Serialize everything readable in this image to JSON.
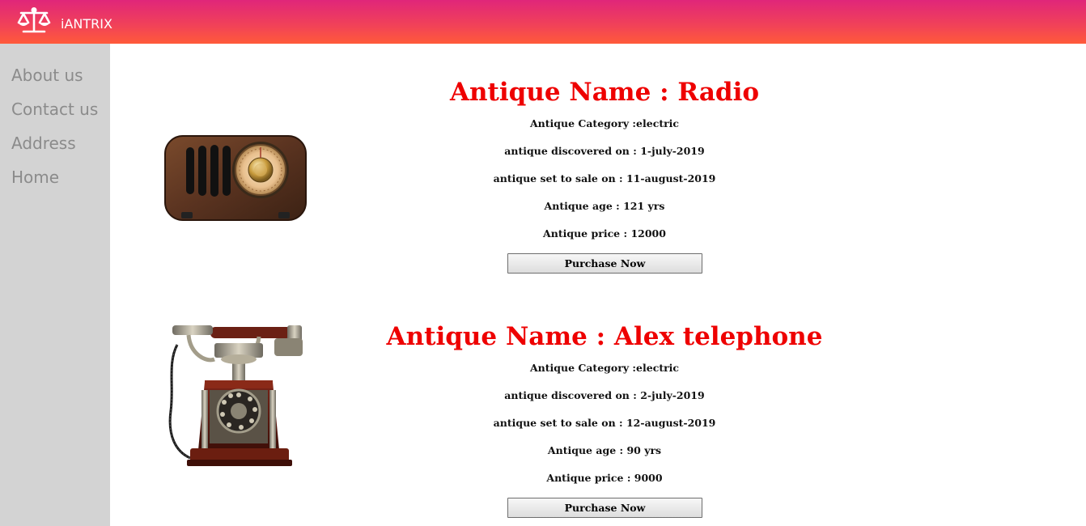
{
  "header": {
    "brand": "iANTRIX",
    "logo_icon": "balance-scale-icon"
  },
  "sidebar": {
    "items": [
      {
        "label": "About us"
      },
      {
        "label": "Contact us"
      },
      {
        "label": "Address"
      },
      {
        "label": "Home"
      }
    ]
  },
  "products": [
    {
      "title": "Antique Name : Radio",
      "category": "Antique Category :electric",
      "discovered": "antique discovered on  : 1-july-2019",
      "sale": "antique set to sale on  : 11-august-2019",
      "age": "Antique age  :  121 yrs",
      "price": "Antique price  : 12000",
      "button": "Purchase Now",
      "image_icon": "vintage-radio-image"
    },
    {
      "title": "Antique Name : Alex telephone",
      "category": "Antique Category :electric",
      "discovered": "antique discovered on  : 2-july-2019",
      "sale": "antique set to sale on  : 12-august-2019",
      "age": "Antique age  : 90 yrs",
      "price": "Antique price  : 9000",
      "button": "Purchase Now",
      "image_icon": "antique-telephone-image"
    }
  ],
  "colors": {
    "header_gradient_top": "#e0267a",
    "header_gradient_bottom": "#ff5a3a",
    "title": "#ee0000",
    "sidebar_bg": "#d3d3d3",
    "nav_text": "#8b8b8b"
  }
}
